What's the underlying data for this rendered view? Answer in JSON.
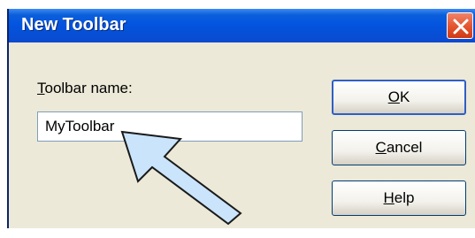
{
  "dialog": {
    "title": "New Toolbar",
    "field_label_accel": "T",
    "field_label_rest": "oolbar name:",
    "field_value": "MyToolbar",
    "ok_accel": "O",
    "ok_rest": "K",
    "cancel_accel": "C",
    "cancel_rest": "ancel",
    "help_accel": "H",
    "help_rest": "elp"
  },
  "icons": {
    "close": "close-icon",
    "pointer": "callout-arrow-icon"
  },
  "colors": {
    "titlebar": "#0454e0",
    "close_button": "#e2532e",
    "dialog_bg": "#ece9d8",
    "arrow_fill": "#c9e4fb",
    "arrow_stroke": "#1a1a1a"
  }
}
